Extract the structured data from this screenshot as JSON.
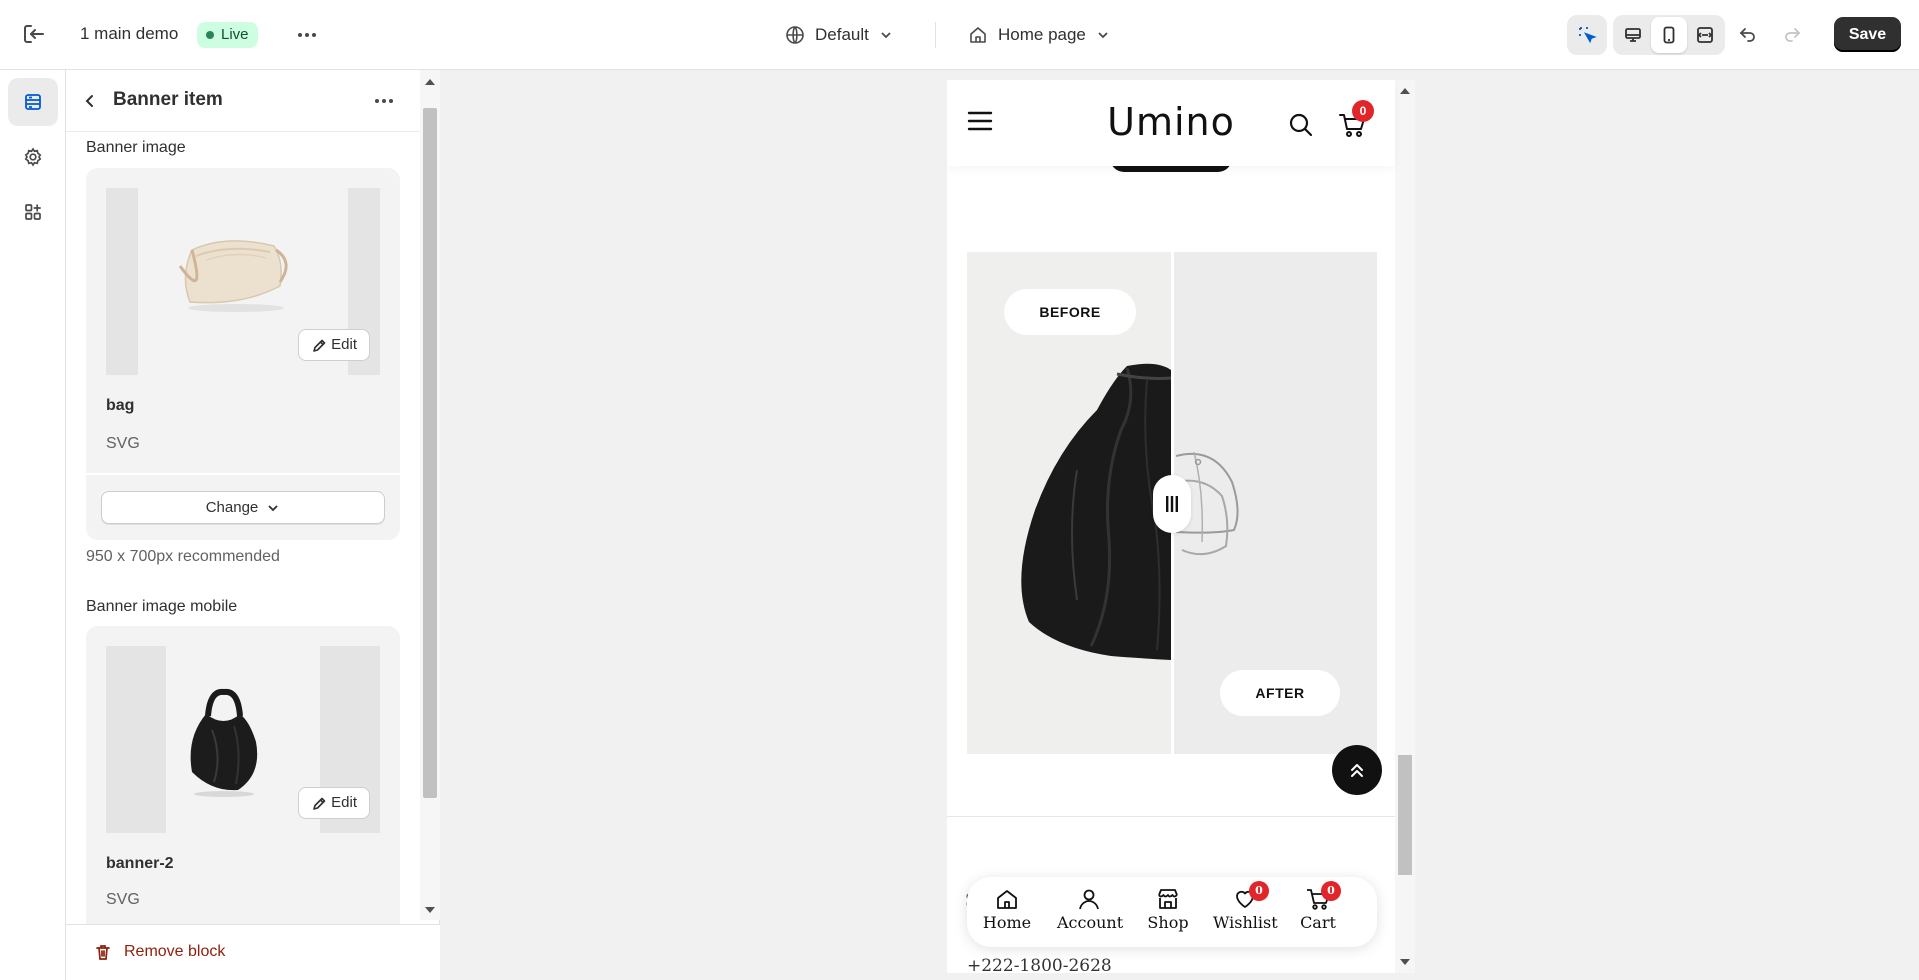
{
  "topbar": {
    "store_name": "1 main demo",
    "live_label": "Live",
    "theme_label": "Default",
    "page_label": "Home page",
    "save_label": "Save"
  },
  "sidebar": {
    "title": "Banner item",
    "banner_image": {
      "label": "Banner image",
      "edit_label": "Edit",
      "file_name": "bag",
      "file_type": "SVG",
      "change_label": "Change",
      "hint": "950 x 700px recommended"
    },
    "banner_image_mobile": {
      "label": "Banner image mobile",
      "edit_label": "Edit",
      "file_name": "banner-2",
      "file_type": "SVG"
    },
    "remove_label": "Remove block"
  },
  "preview": {
    "logo": "Umino",
    "cart_count": "0",
    "before_label": "BEFORE",
    "after_label": "AFTER",
    "peek_text": "S",
    "phone": "+222-1800-2628",
    "bottom_nav": [
      {
        "label": "Home"
      },
      {
        "label": "Account"
      },
      {
        "label": "Shop"
      },
      {
        "label": "Wishlist",
        "count": "0"
      },
      {
        "label": "Cart",
        "count": "0"
      }
    ]
  },
  "colors": {
    "accent": "#005bd3",
    "badge": "#e0262b",
    "danger": "#8e1f0b",
    "live_bg": "#cdfee1"
  }
}
